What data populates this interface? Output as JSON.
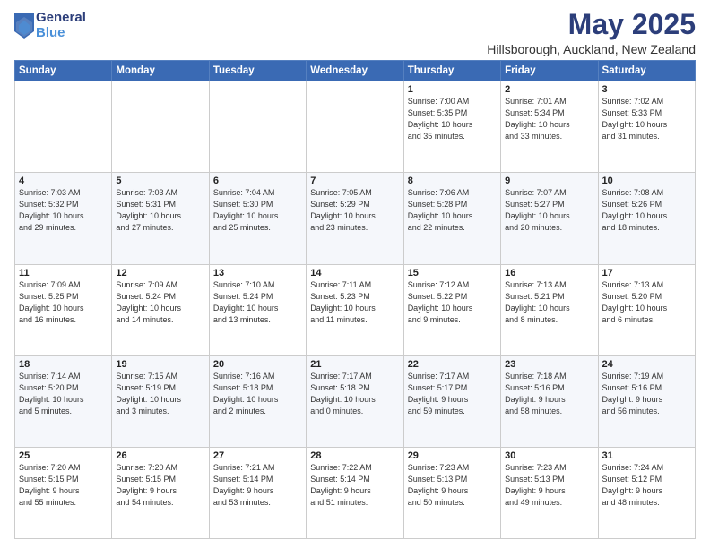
{
  "logo": {
    "general": "General",
    "blue": "Blue"
  },
  "title": "May 2025",
  "subtitle": "Hillsborough, Auckland, New Zealand",
  "header_days": [
    "Sunday",
    "Monday",
    "Tuesday",
    "Wednesday",
    "Thursday",
    "Friday",
    "Saturday"
  ],
  "weeks": [
    [
      {
        "day": "",
        "info": ""
      },
      {
        "day": "",
        "info": ""
      },
      {
        "day": "",
        "info": ""
      },
      {
        "day": "",
        "info": ""
      },
      {
        "day": "1",
        "info": "Sunrise: 7:00 AM\nSunset: 5:35 PM\nDaylight: 10 hours\nand 35 minutes."
      },
      {
        "day": "2",
        "info": "Sunrise: 7:01 AM\nSunset: 5:34 PM\nDaylight: 10 hours\nand 33 minutes."
      },
      {
        "day": "3",
        "info": "Sunrise: 7:02 AM\nSunset: 5:33 PM\nDaylight: 10 hours\nand 31 minutes."
      }
    ],
    [
      {
        "day": "4",
        "info": "Sunrise: 7:03 AM\nSunset: 5:32 PM\nDaylight: 10 hours\nand 29 minutes."
      },
      {
        "day": "5",
        "info": "Sunrise: 7:03 AM\nSunset: 5:31 PM\nDaylight: 10 hours\nand 27 minutes."
      },
      {
        "day": "6",
        "info": "Sunrise: 7:04 AM\nSunset: 5:30 PM\nDaylight: 10 hours\nand 25 minutes."
      },
      {
        "day": "7",
        "info": "Sunrise: 7:05 AM\nSunset: 5:29 PM\nDaylight: 10 hours\nand 23 minutes."
      },
      {
        "day": "8",
        "info": "Sunrise: 7:06 AM\nSunset: 5:28 PM\nDaylight: 10 hours\nand 22 minutes."
      },
      {
        "day": "9",
        "info": "Sunrise: 7:07 AM\nSunset: 5:27 PM\nDaylight: 10 hours\nand 20 minutes."
      },
      {
        "day": "10",
        "info": "Sunrise: 7:08 AM\nSunset: 5:26 PM\nDaylight: 10 hours\nand 18 minutes."
      }
    ],
    [
      {
        "day": "11",
        "info": "Sunrise: 7:09 AM\nSunset: 5:25 PM\nDaylight: 10 hours\nand 16 minutes."
      },
      {
        "day": "12",
        "info": "Sunrise: 7:09 AM\nSunset: 5:24 PM\nDaylight: 10 hours\nand 14 minutes."
      },
      {
        "day": "13",
        "info": "Sunrise: 7:10 AM\nSunset: 5:24 PM\nDaylight: 10 hours\nand 13 minutes."
      },
      {
        "day": "14",
        "info": "Sunrise: 7:11 AM\nSunset: 5:23 PM\nDaylight: 10 hours\nand 11 minutes."
      },
      {
        "day": "15",
        "info": "Sunrise: 7:12 AM\nSunset: 5:22 PM\nDaylight: 10 hours\nand 9 minutes."
      },
      {
        "day": "16",
        "info": "Sunrise: 7:13 AM\nSunset: 5:21 PM\nDaylight: 10 hours\nand 8 minutes."
      },
      {
        "day": "17",
        "info": "Sunrise: 7:13 AM\nSunset: 5:20 PM\nDaylight: 10 hours\nand 6 minutes."
      }
    ],
    [
      {
        "day": "18",
        "info": "Sunrise: 7:14 AM\nSunset: 5:20 PM\nDaylight: 10 hours\nand 5 minutes."
      },
      {
        "day": "19",
        "info": "Sunrise: 7:15 AM\nSunset: 5:19 PM\nDaylight: 10 hours\nand 3 minutes."
      },
      {
        "day": "20",
        "info": "Sunrise: 7:16 AM\nSunset: 5:18 PM\nDaylight: 10 hours\nand 2 minutes."
      },
      {
        "day": "21",
        "info": "Sunrise: 7:17 AM\nSunset: 5:18 PM\nDaylight: 10 hours\nand 0 minutes."
      },
      {
        "day": "22",
        "info": "Sunrise: 7:17 AM\nSunset: 5:17 PM\nDaylight: 9 hours\nand 59 minutes."
      },
      {
        "day": "23",
        "info": "Sunrise: 7:18 AM\nSunset: 5:16 PM\nDaylight: 9 hours\nand 58 minutes."
      },
      {
        "day": "24",
        "info": "Sunrise: 7:19 AM\nSunset: 5:16 PM\nDaylight: 9 hours\nand 56 minutes."
      }
    ],
    [
      {
        "day": "25",
        "info": "Sunrise: 7:20 AM\nSunset: 5:15 PM\nDaylight: 9 hours\nand 55 minutes."
      },
      {
        "day": "26",
        "info": "Sunrise: 7:20 AM\nSunset: 5:15 PM\nDaylight: 9 hours\nand 54 minutes."
      },
      {
        "day": "27",
        "info": "Sunrise: 7:21 AM\nSunset: 5:14 PM\nDaylight: 9 hours\nand 53 minutes."
      },
      {
        "day": "28",
        "info": "Sunrise: 7:22 AM\nSunset: 5:14 PM\nDaylight: 9 hours\nand 51 minutes."
      },
      {
        "day": "29",
        "info": "Sunrise: 7:23 AM\nSunset: 5:13 PM\nDaylight: 9 hours\nand 50 minutes."
      },
      {
        "day": "30",
        "info": "Sunrise: 7:23 AM\nSunset: 5:13 PM\nDaylight: 9 hours\nand 49 minutes."
      },
      {
        "day": "31",
        "info": "Sunrise: 7:24 AM\nSunset: 5:12 PM\nDaylight: 9 hours\nand 48 minutes."
      }
    ]
  ]
}
